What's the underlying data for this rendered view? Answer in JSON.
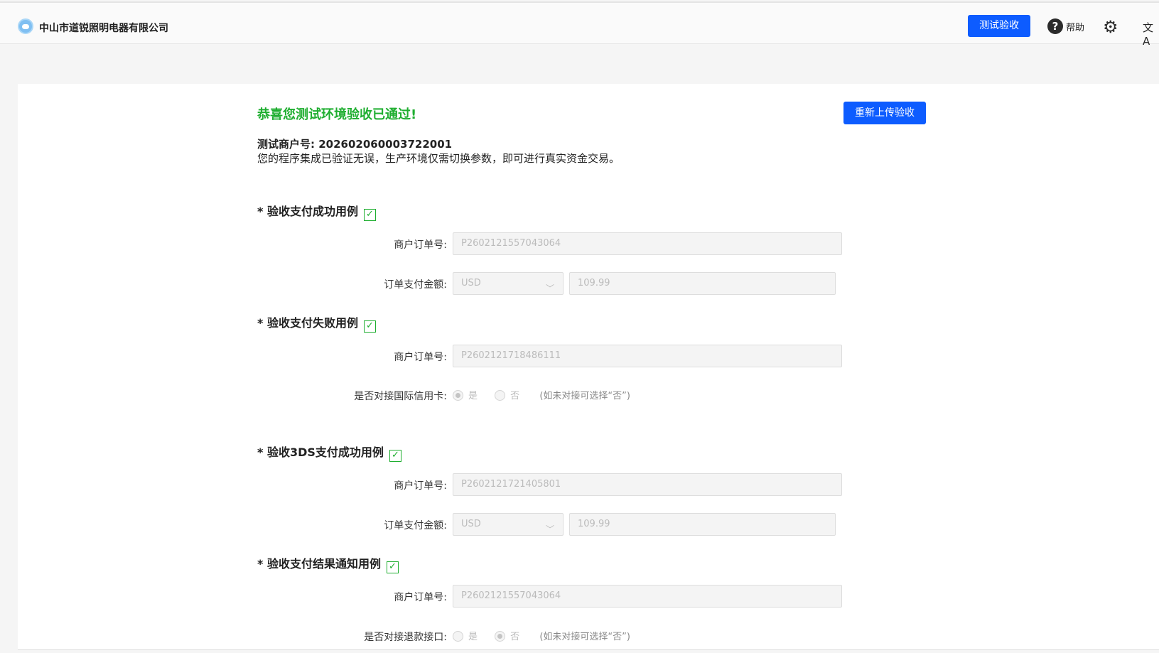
{
  "header": {
    "company": "中山市道锐照明电器有限公司",
    "test_button": "测试验收",
    "help": "帮助",
    "help_icon": "?",
    "gear_icon": "⚙",
    "lang_icon": "文A"
  },
  "result": {
    "title": "恭喜您测试环境验收已通过!",
    "reupload_button": "重新上传验收",
    "merchant_no": "测试商户号: 202602060003722001",
    "description": "您的程序集成已验证无误，生产环境仅需切换参数，即可进行真实资金交易。"
  },
  "labels": {
    "order_no": "商户订单号:",
    "amount": "订单支付金额:",
    "credit_card": "是否对接国际信用卡:",
    "refund": "是否对接退款接口:",
    "yes": "是",
    "no": "否",
    "hint": "(如未对接可选择“否”)",
    "check": "✓"
  },
  "sections": [
    {
      "title": "* 验收支付成功用例",
      "order_no": "P2602121557043064",
      "currency": "USD",
      "amount": "109.99"
    },
    {
      "title": "* 验收支付失败用例",
      "order_no": "P2602121718486111",
      "credit_card_selected": "是"
    },
    {
      "title": "* 验收3DS支付成功用例",
      "order_no": "P2602121721405801",
      "currency": "USD",
      "amount": "109.99"
    },
    {
      "title": "* 验收支付结果通知用例",
      "order_no": "P2602121557043064",
      "refund_selected": "否"
    }
  ]
}
